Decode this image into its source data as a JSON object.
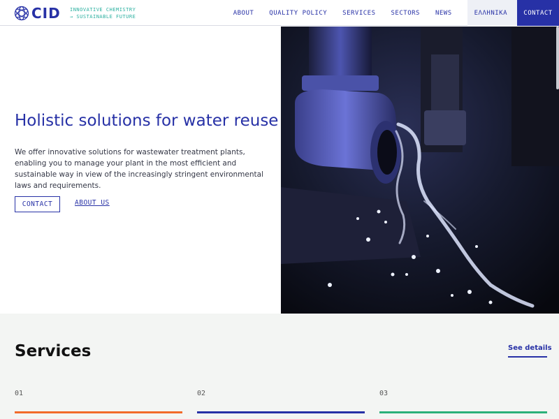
{
  "header": {
    "logo_text": "CID",
    "tagline_line1": "INNOVATIVE CHEMISTRY",
    "tagline_line2": "→ SUSTAINABLE FUTURE",
    "nav": [
      "ABOUT",
      "QUALITY POLICY",
      "SERVICES",
      "SECTORS",
      "NEWS"
    ],
    "lang_label": "ΕΛΛΗΝΙΚΑ",
    "contact_label": "CONTACT"
  },
  "hero": {
    "title": "Holistic solutions for water reuse",
    "text": "We offer innovative solutions for wastewater treatment plants, enabling you to manage your plant in the most efficient and sustainable way in view of the increasingly stringent environmental laws and requirements.",
    "contact_button": "CONTACT",
    "about_link": "ABOUT US"
  },
  "services": {
    "title": "Services",
    "see_details": "See details",
    "items": [
      {
        "number": "01",
        "color": "#f26b2a"
      },
      {
        "number": "02",
        "color": "#2731a6"
      },
      {
        "number": "03",
        "color": "#2bb07a"
      }
    ]
  },
  "colors": {
    "brand_blue": "#2731a6",
    "teal": "#2bb0a0"
  }
}
